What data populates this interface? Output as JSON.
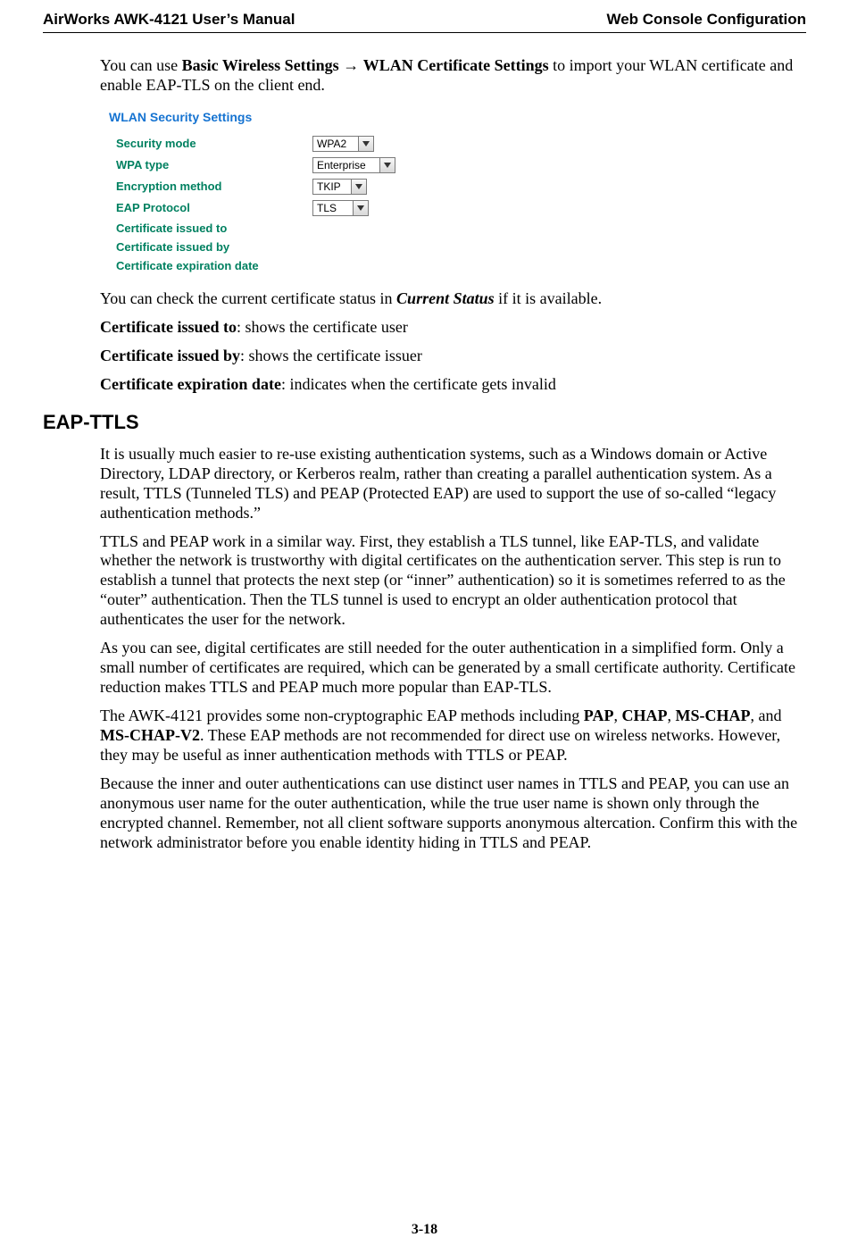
{
  "header": {
    "left": "AirWorks AWK-4121 User’s Manual",
    "right": "Web Console Configuration"
  },
  "intro": {
    "pre": "You can use ",
    "bold1": "Basic Wireless Settings",
    "arrow": " → ",
    "bold2": "WLAN Certificate Settings",
    "post": " to import your WLAN certificate and enable EAP-TLS on the client end."
  },
  "panel": {
    "title": "WLAN Security Settings",
    "rows": {
      "securityMode": {
        "label": "Security mode",
        "value": "WPA2"
      },
      "wpaType": {
        "label": "WPA type",
        "value": "Enterprise"
      },
      "encryption": {
        "label": "Encryption method",
        "value": "TKIP"
      },
      "eapProtocol": {
        "label": "EAP Protocol",
        "value": "TLS"
      },
      "certTo": {
        "label": "Certificate issued to"
      },
      "certBy": {
        "label": "Certificate issued by"
      },
      "certExp": {
        "label": "Certificate expiration date"
      }
    }
  },
  "status": {
    "pre": "You can check the current certificate status in ",
    "boldItalic": "Current Status",
    "post": " if it is available."
  },
  "bullets": {
    "certTo": {
      "bold": "Certificate issued to",
      "rest": ": shows the certificate user"
    },
    "certBy": {
      "bold": "Certificate issued by",
      "rest": ": shows the certificate issuer"
    },
    "certExp": {
      "bold": "Certificate expiration date",
      "rest": ": indicates when the certificate gets invalid"
    }
  },
  "eapttls": {
    "heading": "EAP-TTLS",
    "p1": "It is usually much easier to re-use existing authentication systems, such as a Windows domain or Active Directory, LDAP directory, or Kerberos realm, rather than creating a parallel authentication system. As a result, TTLS (Tunneled TLS) and PEAP (Protected EAP) are used to support the use of so-called “legacy authentication methods.”",
    "p2": "TTLS and PEAP work in a similar way. First, they establish a TLS tunnel, like EAP-TLS, and validate whether the network is trustworthy with digital certificates on the authentication server. This step is run to establish a tunnel that protects the next step (or “inner” authentication) so it is sometimes referred to as the “outer” authentication. Then the TLS tunnel is used to encrypt an older authentication protocol that authenticates the user for the network.",
    "p3": "As you can see, digital certificates are still needed for the outer authentication in a simplified form. Only a small number of certificates are required, which can be generated by a small certificate authority. Certificate reduction makes TTLS and PEAP much more popular than EAP-TLS.",
    "p4": {
      "s1": "The AWK-4121 provides some non-cryptographic EAP methods including ",
      "b1": "PAP",
      "c1": ", ",
      "b2": "CHAP",
      "c2": ", ",
      "b3": "MS-CHAP",
      "c3": ", and ",
      "b4": "MS-CHAP-V2",
      "s2": ". These EAP methods are not recommended for direct use on wireless networks. However, they may be useful as inner authentication methods with TTLS or PEAP."
    },
    "p5": "Because the inner and outer authentications can use distinct user names in TTLS and PEAP, you can use an anonymous user name for the outer authentication, while the true user name is shown only through the encrypted channel. Remember, not all client software supports anonymous altercation. Confirm this with the network administrator before you enable identity hiding in TTLS and PEAP."
  },
  "pageNumber": "3-18"
}
